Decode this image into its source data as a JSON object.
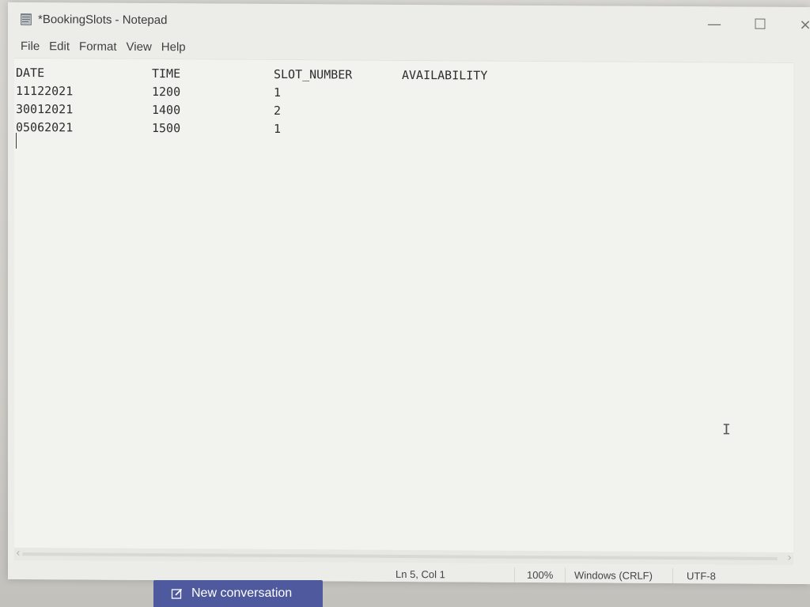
{
  "window": {
    "title": "*BookingSlots - Notepad",
    "controls": {
      "minimize": "—",
      "maximize": "☐",
      "close": "×"
    }
  },
  "menubar": {
    "items": [
      "File",
      "Edit",
      "Format",
      "View",
      "Help"
    ]
  },
  "editor": {
    "headers": {
      "date": "DATE",
      "time": "TIME",
      "slot_number": "SLOT_NUMBER",
      "availability": "AVAILABILITY"
    },
    "rows": [
      {
        "date": "11122021",
        "time": "1200",
        "slot": "1",
        "availability": ""
      },
      {
        "date": "30012021",
        "time": "1400",
        "slot": "2",
        "availability": ""
      },
      {
        "date": "05062021",
        "time": "1500",
        "slot": "1",
        "availability": ""
      }
    ]
  },
  "statusbar": {
    "position": "Ln 5, Col 1",
    "zoom": "100%",
    "line_endings": "Windows (CRLF)",
    "encoding": "UTF-8"
  },
  "taskbar": {
    "new_conversation_label": "New conversation"
  },
  "icons": {
    "app": "notepad-icon",
    "compose": "compose-icon",
    "ibeam": "text-cursor-icon"
  },
  "colors": {
    "accent_button": "#4f5a9e",
    "window_bg": "#ecece8",
    "editor_bg": "#f2f2ef",
    "text": "#2d2d2d"
  }
}
